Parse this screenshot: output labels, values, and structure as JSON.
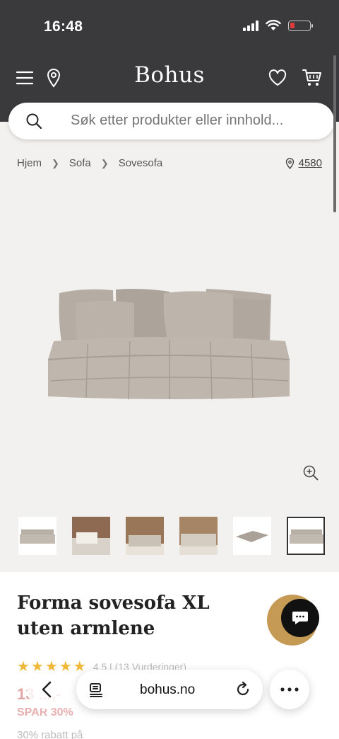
{
  "status": {
    "time": "16:48"
  },
  "header": {
    "logo": "Bohus"
  },
  "search": {
    "placeholder": "Søk etter produkter eller innhold..."
  },
  "breadcrumb": {
    "items": [
      "Hjem",
      "Sofa",
      "Sovesofa"
    ]
  },
  "store": {
    "number": "4580"
  },
  "gallery": {
    "thumbnail_count": 6,
    "active_index": 5
  },
  "product": {
    "title": "Forma sovesofa XL uten armlene",
    "rating_text": "4.5 | (13 Vurderinger)",
    "price": "13 ...,-",
    "save_label": "SPAR 30%",
    "discount_text": "30% rabatt på"
  },
  "browser": {
    "url": "bohus.no"
  },
  "colors": {
    "header": "#3a3a3d",
    "accent_gold": "#c59a55",
    "star": "#f0b838"
  }
}
